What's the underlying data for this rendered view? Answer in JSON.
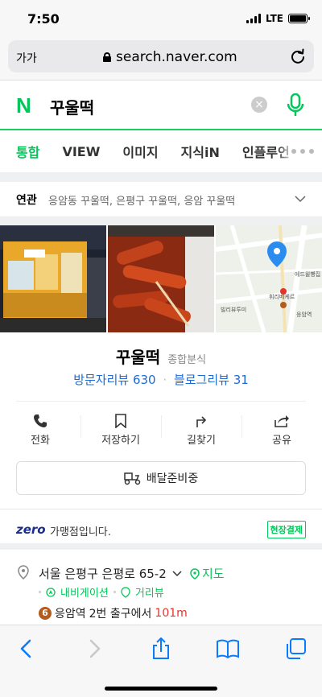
{
  "status": {
    "time": "7:50",
    "network": "LTE"
  },
  "browser": {
    "text_size_label": "가가",
    "url": "search.naver.com"
  },
  "search": {
    "logo": "N",
    "query": "꾸울떡",
    "clear_label": "×"
  },
  "tabs": [
    {
      "label": "통합",
      "active": true
    },
    {
      "label": "VIEW"
    },
    {
      "label": "이미지"
    },
    {
      "label": "지식iN"
    },
    {
      "label": "인플루언"
    }
  ],
  "related": {
    "label": "연관",
    "items": "응암동 꾸울떡, 은평구 꾸울떡, 응암 꾸울떡"
  },
  "map_labels": {
    "shop1": "에드윌빵집",
    "shop2": "휘리베케르",
    "shop3": "빌리뷰투미",
    "station": "응암역"
  },
  "place": {
    "name": "꾸울떡",
    "category": "종합분식",
    "visitor_reviews": "방문자리뷰 630",
    "blog_reviews": "블로그리뷰 31",
    "actions": [
      "전화",
      "저장하기",
      "길찾기",
      "공유"
    ],
    "delivery_label": "배달준비중"
  },
  "zero_pay": {
    "logo": "zero",
    "text": "가맹점입니다.",
    "badge": "현장결제"
  },
  "address": {
    "text": "서울 은평구 은평로 65-2",
    "map_link": "지도",
    "navigation": "내비게이션",
    "street_view": "거리뷰",
    "line_number": "6",
    "station": "응암역",
    "exit": "2번 출구에서",
    "distance": "101m"
  },
  "colors": {
    "naver_green": "#03c75a",
    "link_blue": "#1c6bd5",
    "subway_line6": "#b35c1e",
    "distance_red": "#e5322d"
  }
}
